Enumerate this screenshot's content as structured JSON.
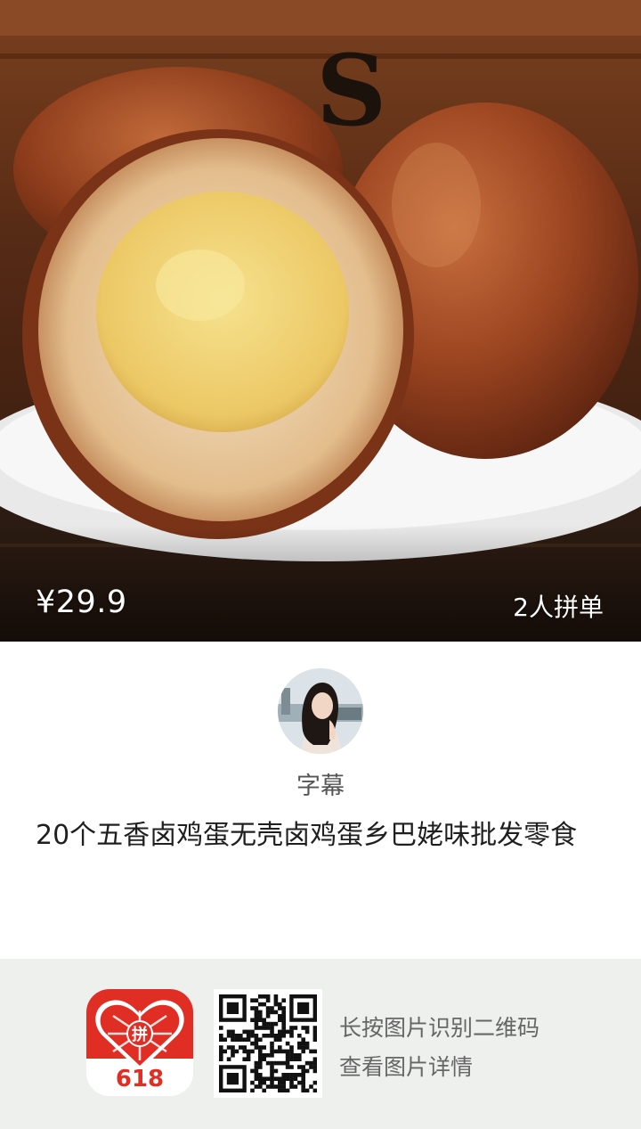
{
  "product": {
    "price": "¥29.9",
    "group_count": "2人拼单",
    "title": "20个五香卤鸡蛋无壳卤鸡蛋乡巴姥味批发零食"
  },
  "seller": {
    "nickname": "字幕"
  },
  "footer": {
    "app_logo_number": "618",
    "app_logo_char": "拼",
    "line1": "长按图片识别二维码",
    "line2": "查看图片详情"
  },
  "colors": {
    "brand_red": "#e02e24",
    "footer_bg": "#eef0ee",
    "egg_brown": "#8b3a1a",
    "yolk": "#f0d276"
  },
  "icons": [
    "app-logo-icon",
    "qr-code-icon",
    "avatar"
  ]
}
